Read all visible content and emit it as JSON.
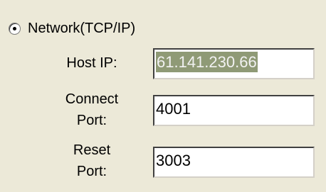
{
  "network_option": {
    "label": "Network(TCP/IP)",
    "selected": true
  },
  "host_ip": {
    "label": "Host IP:",
    "value": "61.141.230.66"
  },
  "connect_port": {
    "label_line1": "Connect",
    "label_line2": "Port:",
    "value": "4001"
  },
  "reset_port": {
    "label_line1": "Reset",
    "label_line2": "Port:",
    "value": "3003"
  }
}
